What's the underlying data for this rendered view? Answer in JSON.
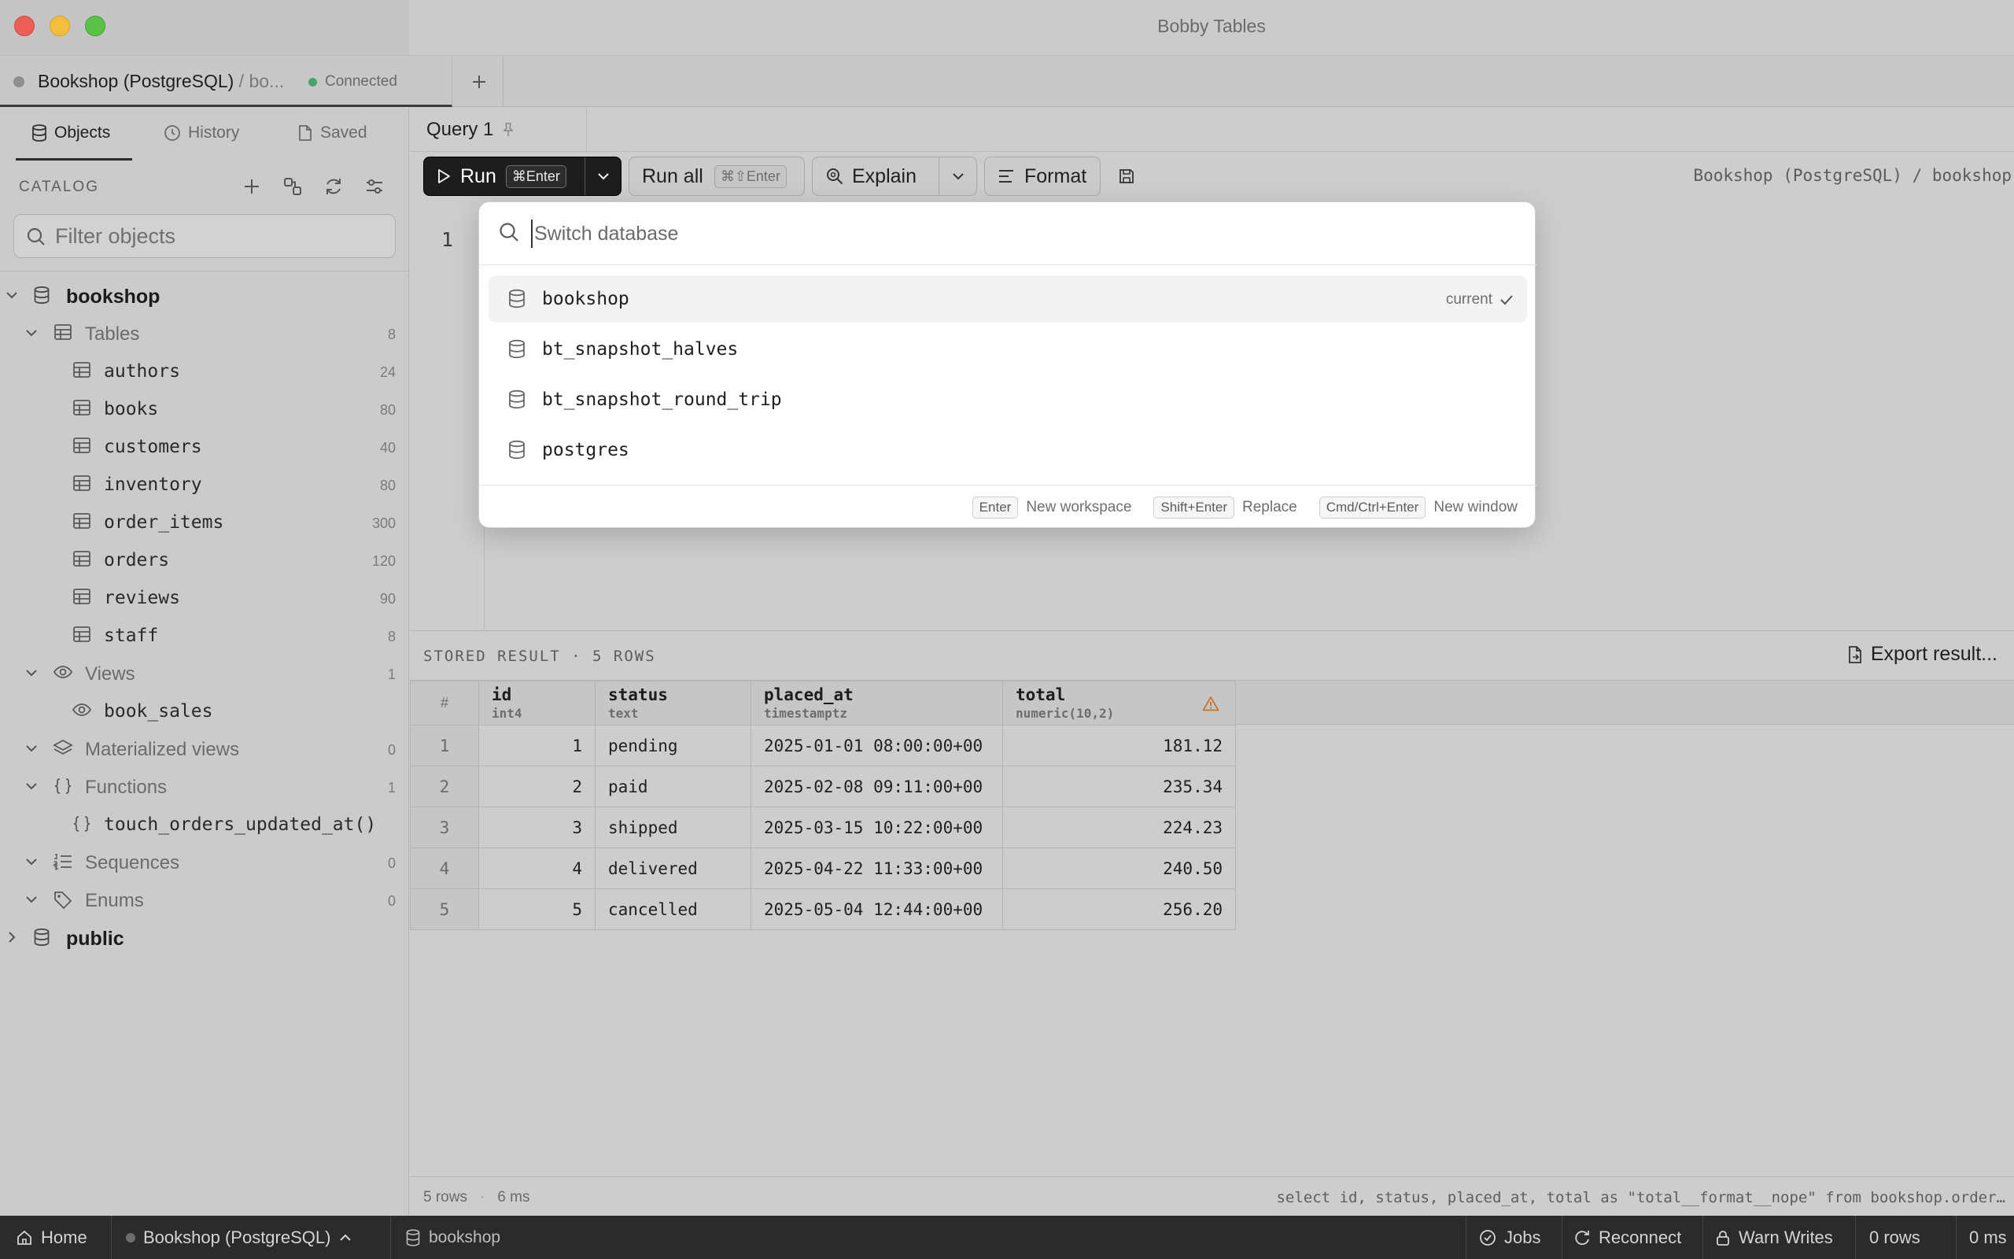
{
  "window": {
    "title": "Bobby Tables"
  },
  "connection_tab": {
    "name": "Bookshop (PostgreSQL)",
    "db_separator": " / ",
    "db_short": "bo...",
    "status": "Connected"
  },
  "sidebar": {
    "tabs": [
      {
        "label": "Objects",
        "icon": "database-icon",
        "active": true
      },
      {
        "label": "History",
        "icon": "clock-icon",
        "active": false
      },
      {
        "label": "Saved",
        "icon": "document-icon",
        "active": false
      }
    ],
    "catalog_label": "CATALOG",
    "filter_placeholder": "Filter objects",
    "tree": {
      "db": "bookshop",
      "tables_label": "Tables",
      "tables_count": "8",
      "tables": [
        {
          "name": "authors",
          "count": "24"
        },
        {
          "name": "books",
          "count": "80"
        },
        {
          "name": "customers",
          "count": "40"
        },
        {
          "name": "inventory",
          "count": "80"
        },
        {
          "name": "order_items",
          "count": "300"
        },
        {
          "name": "orders",
          "count": "120"
        },
        {
          "name": "reviews",
          "count": "90"
        },
        {
          "name": "staff",
          "count": "8"
        }
      ],
      "views_label": "Views",
      "views_count": "1",
      "views": [
        {
          "name": "book_sales"
        }
      ],
      "matviews_label": "Materialized views",
      "matviews_count": "0",
      "functions_label": "Functions",
      "functions_count": "1",
      "functions": [
        {
          "name": "touch_orders_updated_at()"
        }
      ],
      "sequences_label": "Sequences",
      "sequences_count": "0",
      "enums_label": "Enums",
      "enums_count": "0",
      "schema2": "public"
    }
  },
  "query_tab": {
    "label": "Query 1"
  },
  "toolbar": {
    "run_label": "Run",
    "run_kbd": "⌘Enter",
    "run_all_label": "Run all",
    "run_all_kbd": "⌘⇧Enter",
    "explain_label": "Explain",
    "format_label": "Format",
    "path": "Bookshop (PostgreSQL) / bookshop"
  },
  "editor": {
    "line_number": "1"
  },
  "results": {
    "title": "STORED RESULT · 5 ROWS",
    "export_label": "Export result...",
    "row_header": "#",
    "columns": [
      {
        "name": "id",
        "type": "int4"
      },
      {
        "name": "status",
        "type": "text"
      },
      {
        "name": "placed_at",
        "type": "timestamptz"
      },
      {
        "name": "total",
        "type": "numeric(10,2)"
      }
    ],
    "rows": [
      [
        "1",
        "1",
        "pending",
        "2025-01-01 08:00:00+00",
        "181.12"
      ],
      [
        "2",
        "2",
        "paid",
        "2025-02-08 09:11:00+00",
        "235.34"
      ],
      [
        "3",
        "3",
        "shipped",
        "2025-03-15 10:22:00+00",
        "224.23"
      ],
      [
        "4",
        "4",
        "delivered",
        "2025-04-22 11:33:00+00",
        "240.50"
      ],
      [
        "5",
        "5",
        "cancelled",
        "2025-05-04 12:44:00+00",
        "256.20"
      ]
    ]
  },
  "statusline": {
    "rows": "5 rows",
    "time": "6 ms",
    "sql": "select id, status, placed_at, total as \"total__format__nope\" from bookshop.order…"
  },
  "bottombar": {
    "home": "Home",
    "connection": "Bookshop (PostgreSQL)",
    "database": "bookshop",
    "jobs": "Jobs",
    "reconnect": "Reconnect",
    "warn_writes": "Warn Writes",
    "rows": "0 rows",
    "time": "0 ms"
  },
  "switcher": {
    "placeholder": "Switch database",
    "items": [
      {
        "name": "bookshop",
        "current": true
      },
      {
        "name": "bt_snapshot_halves",
        "current": false
      },
      {
        "name": "bt_snapshot_round_trip",
        "current": false
      },
      {
        "name": "postgres",
        "current": false
      }
    ],
    "current_label": "current",
    "hints": [
      {
        "key": "Enter",
        "label": "New workspace"
      },
      {
        "key": "Shift+Enter",
        "label": "Replace"
      },
      {
        "key": "Cmd/Ctrl+Enter",
        "label": "New window"
      }
    ]
  },
  "colors": {
    "accent_dark": "#1d1d1d",
    "connected": "#4aa36f",
    "warning": "#c8732a"
  }
}
